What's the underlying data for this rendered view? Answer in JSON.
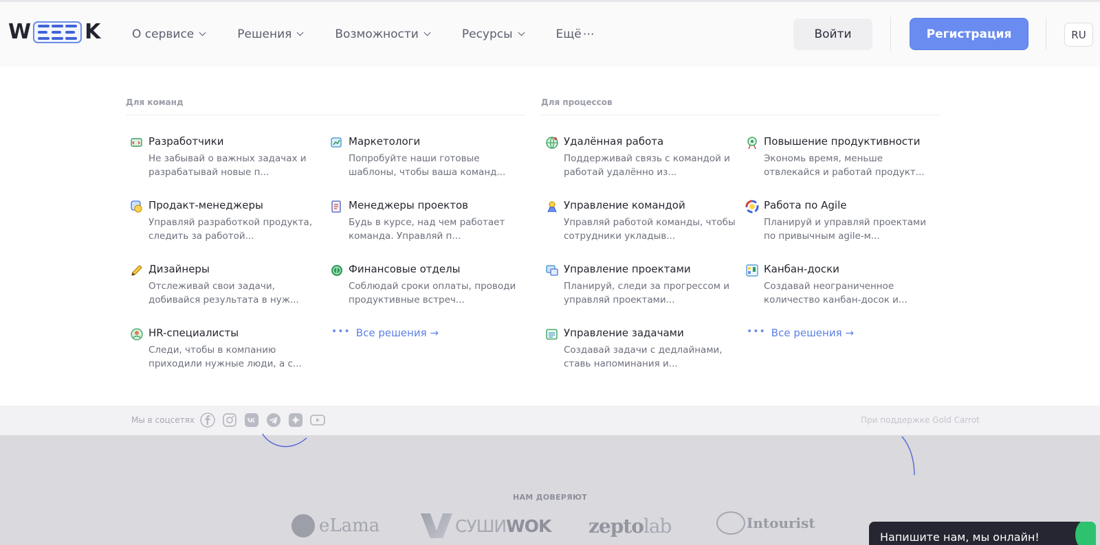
{
  "header": {
    "logo_text": "WEEEK",
    "nav": [
      {
        "label": "О сервисе",
        "has_chevron": true
      },
      {
        "label": "Решения",
        "has_chevron": true
      },
      {
        "label": "Возможности",
        "has_chevron": true
      },
      {
        "label": "Ресурсы",
        "has_chevron": true
      },
      {
        "label": "Ещё",
        "has_chevron": false
      }
    ],
    "login_label": "Войти",
    "register_label": "Регистрация",
    "lang_label": "RU"
  },
  "menu": {
    "teams": {
      "heading": "Для команд",
      "items": [
        {
          "title": "Разработчики",
          "desc": "Не забывай о важных задачах и разрабатывай новые п...",
          "icon": "developer-icon"
        },
        {
          "title": "Маркетологи",
          "desc": "Попробуйте наши готовые шаблоны, чтобы ваша команд...",
          "icon": "marketing-icon"
        },
        {
          "title": "Продакт-менеджеры",
          "desc": "Управляй разработкой продукта, следить за работой...",
          "icon": "product-icon"
        },
        {
          "title": "Менеджеры проектов",
          "desc": "Будь в курсе, над чем работает команда. Управляй п...",
          "icon": "project-manager-icon"
        },
        {
          "title": "Дизайнеры",
          "desc": "Отслеживай свои задачи, добивайся результата в нуж...",
          "icon": "designer-icon"
        },
        {
          "title": "Финансовые отделы",
          "desc": "Соблюдай сроки оплаты, проводи продуктивные встреч...",
          "icon": "finance-icon"
        },
        {
          "title": "HR-специалисты",
          "desc": "Следи, чтобы в компанию приходили нужные люди, а с...",
          "icon": "hr-icon"
        }
      ],
      "all_label": "Все решения →"
    },
    "processes": {
      "heading": "Для процессов",
      "items": [
        {
          "title": "Удалённая работа",
          "desc": "Поддерживай связь с командой и работай удалённо из...",
          "icon": "remote-work-icon"
        },
        {
          "title": "Повышение продуктивности",
          "desc": "Экономь время, меньше отвлекайся и работай продукт...",
          "icon": "productivity-icon"
        },
        {
          "title": "Управление командой",
          "desc": "Управляй работой команды, чтобы сотрудники укладыв...",
          "icon": "team-management-icon"
        },
        {
          "title": "Работа по Agile",
          "desc": "Планируй и управляй проектами по привычным agile-м...",
          "icon": "agile-icon"
        },
        {
          "title": "Управление проектами",
          "desc": "Планируй, следи за прогрессом и управляй проектами...",
          "icon": "project-management-icon"
        },
        {
          "title": "Канбан-доски",
          "desc": "Создавай неограниченное количество канбан-досок и...",
          "icon": "kanban-icon"
        },
        {
          "title": "Управление задачами",
          "desc": "Создавай задачи с дедлайнами, ставь напоминания и...",
          "icon": "task-management-icon"
        }
      ],
      "all_label": "Все решения →"
    }
  },
  "panel_footer": {
    "social_label": "Мы в соцсетях",
    "social_icons": [
      "facebook-icon",
      "instagram-icon",
      "vk-icon",
      "telegram-icon",
      "zen-icon",
      "youtube-icon"
    ],
    "support_text": "При поддержке Gold Carrot"
  },
  "background": {
    "trust_heading": "НАМ ДОВЕРЯЮТ",
    "partners": {
      "elama": "eLama",
      "sushiwok_a": "СУШИ",
      "sushiwok_b": "WOK",
      "zepto_a": "zepto",
      "zepto_b": "lab",
      "intourist": "Intourist"
    }
  },
  "chat": {
    "label": "Напишите нам, мы онлайн!"
  },
  "colors": {
    "accent": "#6a8cf0",
    "link": "#5b80e8",
    "text": "#25262f",
    "muted": "#6c6f7d"
  }
}
